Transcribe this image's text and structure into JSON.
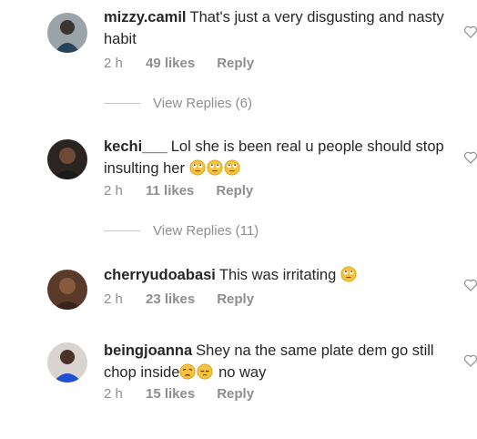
{
  "comments": [
    {
      "username": "mizzy.camil",
      "text": "That's just a very disgusting and nasty habit",
      "emojis": [],
      "time": "2 h",
      "likes": "49 likes",
      "reply": "Reply",
      "view_replies": "View Replies (6)"
    },
    {
      "username": "kechi___",
      "text": "Lol she is been real u people should stop insulting her",
      "emojis": [
        "eye-roll-emoji",
        "eye-roll-emoji",
        "eye-roll-emoji"
      ],
      "time": "2 h",
      "likes": "11 likes",
      "reply": "Reply",
      "view_replies": "View Replies (11)"
    },
    {
      "username": "cherryudoabasi",
      "text": "This was irritating",
      "emojis": [
        "eye-roll-emoji"
      ],
      "time": "2 h",
      "likes": "23 likes",
      "reply": "Reply"
    },
    {
      "username": "beingjoanna",
      "text": "Shey na the same plate dem go still chop inside",
      "emojis": [
        "weary-emoji",
        "pensive-emoji"
      ],
      "text_after": "no way",
      "time": "2 h",
      "likes": "15 likes",
      "reply": "Reply"
    }
  ],
  "icons": {
    "like": "heart-outline-icon"
  },
  "colors": {
    "text": "#262626",
    "meta": "#8e8e8e",
    "divider": "#c7c7c7",
    "emoji": "#f7c33a"
  }
}
